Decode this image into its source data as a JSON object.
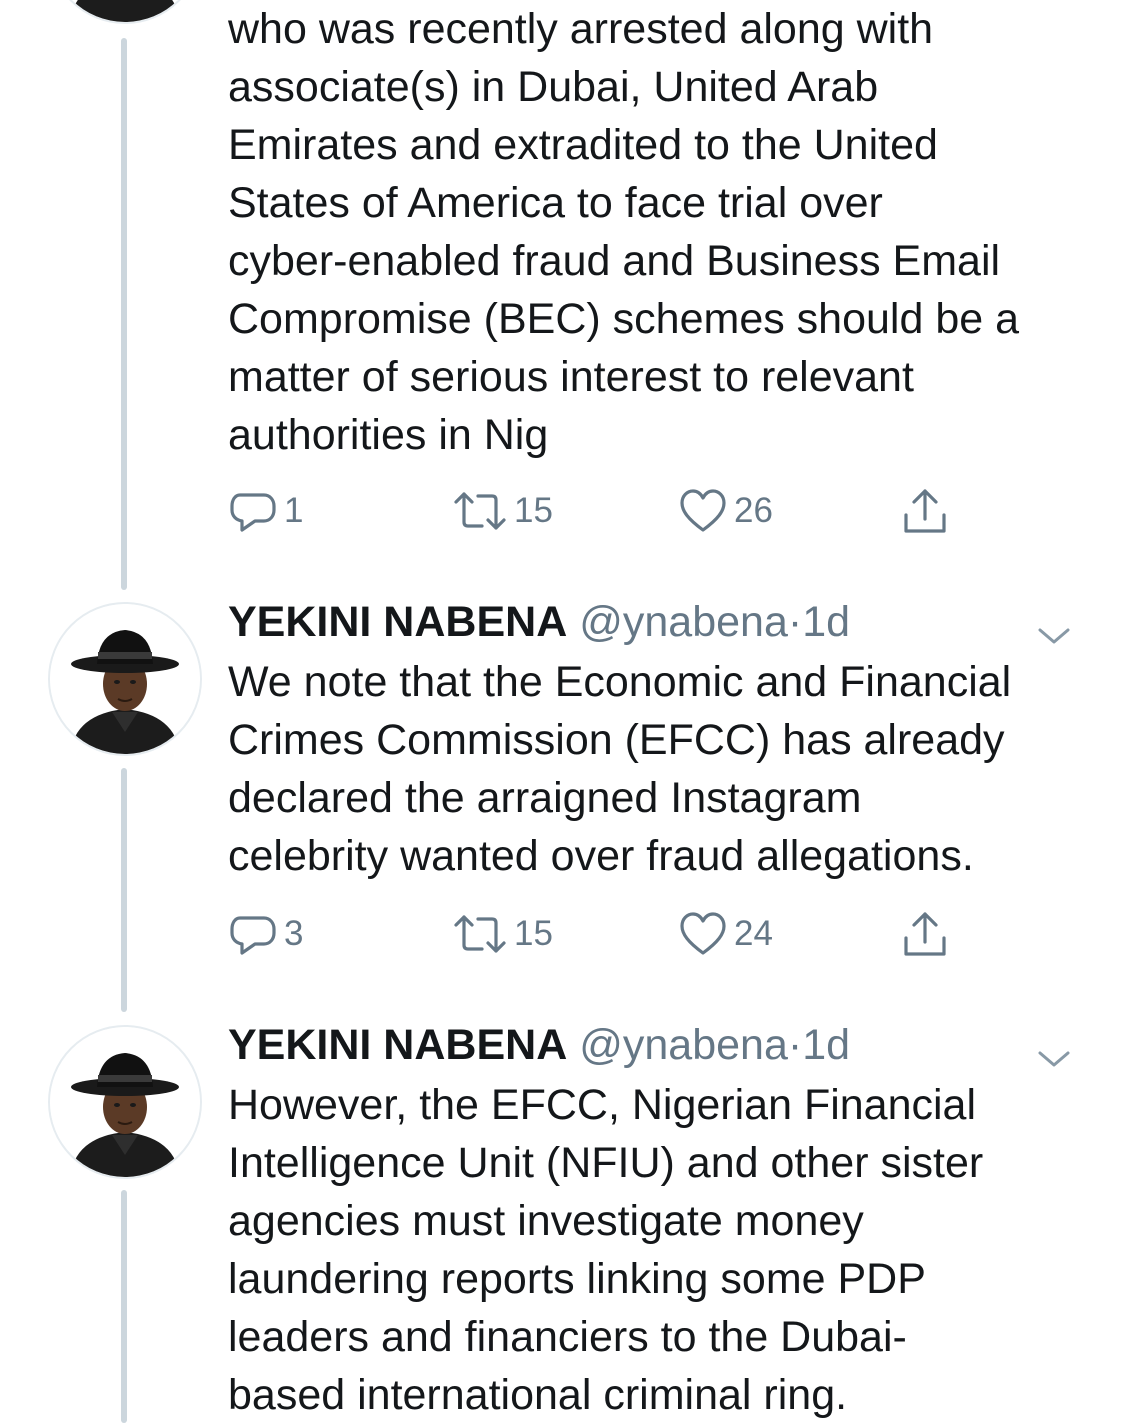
{
  "tweets": [
    {
      "text": "who was recently arrested along with\nassociate(s) in Dubai, United Arab\nEmirates and extradited to the United\nStates of America to face trial over\ncyber-enabled fraud and Business Email\nCompromise (BEC) schemes should be a\nmatter of serious interest to relevant\nauthorities in Nig",
      "replies": "1",
      "retweets": "15",
      "likes": "26"
    },
    {
      "author_name": "YEKINI NABENA",
      "author_handle": "@ynabena",
      "separator": "·",
      "timestamp": "1d",
      "text": "We note that the Economic and Financial\nCrimes Commission (EFCC) has already\ndeclared the arraigned Instagram\ncelebrity wanted over fraud allegations.",
      "replies": "3",
      "retweets": "15",
      "likes": "24"
    },
    {
      "author_name": "YEKINI NABENA",
      "author_handle": "@ynabena",
      "separator": "·",
      "timestamp": "1d",
      "text": "However, the EFCC, Nigerian Financial\nIntelligence Unit (NFIU) and other sister\nagencies must investigate money\nlaundering reports linking some PDP\nleaders and financiers to the Dubai-\nbased international criminal ring."
    }
  ],
  "icons": {
    "reply": "reply-icon",
    "retweet": "retweet-icon",
    "like": "heart-icon",
    "share": "share-icon",
    "menu": "chevron-down-icon"
  },
  "colors": {
    "text": "#14171a",
    "secondary": "#657786",
    "thread_line": "#ccd6dd"
  }
}
